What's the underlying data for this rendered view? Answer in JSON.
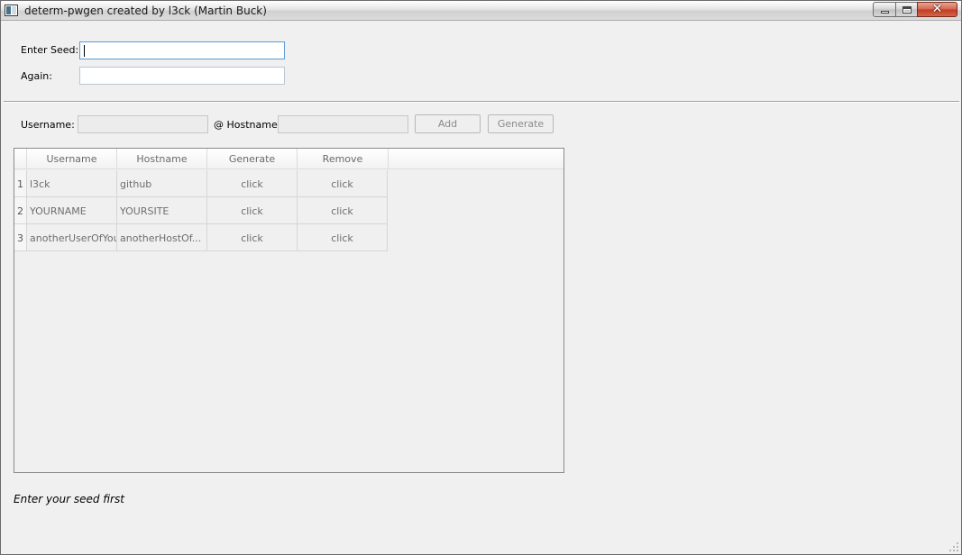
{
  "window": {
    "title": "determ-pwgen created by l3ck (Martin Buck)",
    "controls": {
      "minimize": "minimize",
      "maximize": "maximize",
      "close": "✕"
    }
  },
  "seed": {
    "enter_label": "Enter Seed:",
    "enter_value": "",
    "again_label": "Again:",
    "again_value": ""
  },
  "entry": {
    "username_label": "Username:",
    "username_value": "",
    "hostname_label": "@ Hostname:",
    "hostname_value": "",
    "add_label": "Add",
    "generate_label": "Generate"
  },
  "table": {
    "columns": [
      "Username",
      "Hostname",
      "Generate",
      "Remove"
    ],
    "rows": [
      {
        "num": "1",
        "username": "l3ck",
        "hostname": "github",
        "generate": "click",
        "remove": "click"
      },
      {
        "num": "2",
        "username": "YOURNAME",
        "hostname": "YOURSITE",
        "generate": "click",
        "remove": "click"
      },
      {
        "num": "3",
        "username": "anotherUserOfYou",
        "hostname": "anotherHostOf...",
        "generate": "click",
        "remove": "click"
      }
    ]
  },
  "status": {
    "text": "Enter your seed first"
  }
}
